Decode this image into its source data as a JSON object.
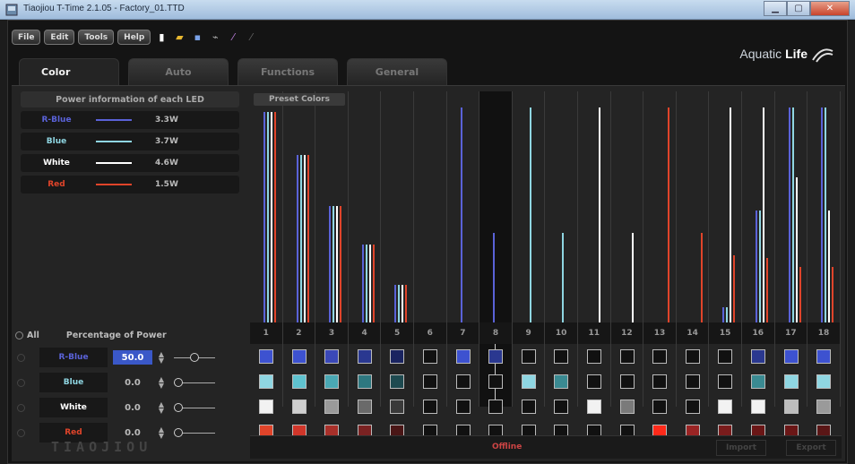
{
  "window": {
    "title": "Tiaojiou T-Time 2.1.05 - Factory_01.TTD"
  },
  "menu": {
    "file": "File",
    "edit": "Edit",
    "tools": "Tools",
    "help": "Help"
  },
  "tabs": [
    {
      "label": "Color"
    },
    {
      "label": "Auto"
    },
    {
      "label": "Functions"
    },
    {
      "label": "General"
    }
  ],
  "logo": {
    "part1": "Aquatic",
    "part2": "Life"
  },
  "power": {
    "title": "Power information of each LED",
    "rows": [
      {
        "name": "R-Blue",
        "watts": "3.3W",
        "color": "#5a62d8"
      },
      {
        "name": "Blue",
        "watts": "3.7W",
        "color": "#8fd6e2"
      },
      {
        "name": "White",
        "watts": "4.6W",
        "color": "#ffffff"
      },
      {
        "name": "Red",
        "watts": "1.5W",
        "color": "#e0442a"
      }
    ]
  },
  "controls": {
    "all_label": "All",
    "pct_label": "Percentage of Power",
    "rows": [
      {
        "name": "R-Blue",
        "value": "50.0",
        "selected": true,
        "slider": 0.5,
        "color": "#5a62d8"
      },
      {
        "name": "Blue",
        "value": "0.0",
        "selected": false,
        "slider": 0,
        "color": "#8fd6e2"
      },
      {
        "name": "White",
        "value": "0.0",
        "selected": false,
        "slider": 0,
        "color": "#ffffff"
      },
      {
        "name": "Red",
        "value": "0.0",
        "selected": false,
        "slider": 0,
        "color": "#e0442a"
      }
    ]
  },
  "brand": "TIAOJIOU",
  "preset_label": "Preset Colors",
  "selected_channel": 8,
  "channels": [
    {
      "label": "1",
      "levels": [
        0.94,
        0.94,
        0.94,
        0.94
      ],
      "swatches": [
        "#3d52d0",
        "#8fd6e2",
        "#f2f2f2",
        "#e0442a"
      ]
    },
    {
      "label": "2",
      "levels": [
        0.75,
        0.75,
        0.75,
        0.75
      ],
      "swatches": [
        "#3d52d0",
        "#5fc2cf",
        "#cfcfcf",
        "#d0362a"
      ]
    },
    {
      "label": "3",
      "levels": [
        0.52,
        0.52,
        0.52,
        0.52
      ],
      "swatches": [
        "#3a48b8",
        "#4aa8b4",
        "#9a9a9a",
        "#a8302a"
      ]
    },
    {
      "label": "4",
      "levels": [
        0.35,
        0.35,
        0.35,
        0.35
      ],
      "swatches": [
        "#2a3890",
        "#2e7880",
        "#6a6a6a",
        "#7a2222"
      ]
    },
    {
      "label": "5",
      "levels": [
        0.17,
        0.17,
        0.17,
        0.17
      ],
      "swatches": [
        "#1a2460",
        "#1e4a50",
        "#3a3a3a",
        "#4a1616"
      ]
    },
    {
      "label": "6",
      "levels": [
        0,
        0,
        0,
        0
      ],
      "swatches": [
        "#111111",
        "#111111",
        "#111111",
        "#111111"
      ]
    },
    {
      "label": "7",
      "levels": [
        0.96,
        0,
        0,
        0
      ],
      "swatches": [
        "#3d52d0",
        "#111111",
        "#111111",
        "#111111"
      ]
    },
    {
      "label": "8",
      "levels": [
        0.4,
        0,
        0,
        0
      ],
      "swatches": [
        "#2a3890",
        "#111111",
        "#111111",
        "#111111"
      ]
    },
    {
      "label": "9",
      "levels": [
        0,
        0.96,
        0,
        0
      ],
      "swatches": [
        "#111111",
        "#8fd6e2",
        "#111111",
        "#111111"
      ]
    },
    {
      "label": "10",
      "levels": [
        0,
        0.4,
        0,
        0
      ],
      "swatches": [
        "#111111",
        "#3a8a92",
        "#111111",
        "#111111"
      ]
    },
    {
      "label": "11",
      "levels": [
        0,
        0,
        0.96,
        0
      ],
      "swatches": [
        "#111111",
        "#111111",
        "#f2f2f2",
        "#111111"
      ]
    },
    {
      "label": "12",
      "levels": [
        0,
        0,
        0.4,
        0
      ],
      "swatches": [
        "#111111",
        "#111111",
        "#7a7a7a",
        "#111111"
      ]
    },
    {
      "label": "13",
      "levels": [
        0,
        0,
        0,
        0.96
      ],
      "swatches": [
        "#111111",
        "#111111",
        "#111111",
        "#ff2a1a"
      ]
    },
    {
      "label": "14",
      "levels": [
        0,
        0,
        0,
        0.4
      ],
      "swatches": [
        "#111111",
        "#111111",
        "#111111",
        "#9a2424"
      ]
    },
    {
      "label": "15",
      "levels": [
        0.07,
        0.07,
        0.96,
        0.3
      ],
      "swatches": [
        "#111111",
        "#111111",
        "#f2f2f2",
        "#7a1c1c"
      ]
    },
    {
      "label": "16",
      "levels": [
        0.5,
        0.5,
        0.96,
        0.29
      ],
      "swatches": [
        "#2a3890",
        "#3a8a92",
        "#f2f2f2",
        "#6a1616"
      ]
    },
    {
      "label": "17",
      "levels": [
        0.96,
        0.96,
        0.65,
        0.25
      ],
      "swatches": [
        "#3d52d0",
        "#8fd6e2",
        "#bdbdbd",
        "#6a1616"
      ]
    },
    {
      "label": "18",
      "levels": [
        0.96,
        0.96,
        0.5,
        0.25
      ],
      "swatches": [
        "#3d52d0",
        "#8fd6e2",
        "#9a9a9a",
        "#5a1616"
      ]
    }
  ],
  "status": {
    "text": "Offline",
    "import": "Import",
    "export": "Export"
  }
}
